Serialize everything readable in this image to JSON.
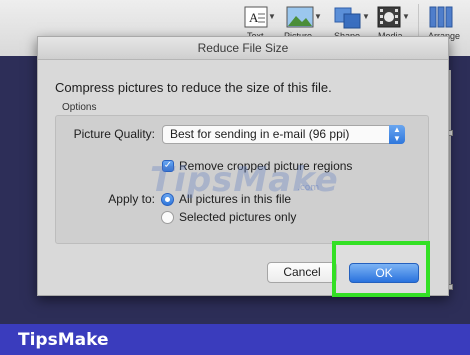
{
  "ribbon": {
    "items": [
      {
        "label": "Text",
        "icon": "text-box-icon"
      },
      {
        "label": "Picture",
        "icon": "picture-icon"
      },
      {
        "label": "Shape",
        "icon": "shape-icon"
      },
      {
        "label": "Media",
        "icon": "media-film-icon"
      },
      {
        "label": "Arrange",
        "icon": "arrange-icon"
      }
    ]
  },
  "dialog": {
    "title": "Reduce File Size",
    "description": "Compress pictures to reduce the size of this file.",
    "options_legend": "Options",
    "picture_quality_label": "Picture Quality:",
    "picture_quality_value": "Best for sending in e-mail (96 ppi)",
    "remove_cropped_label": "Remove cropped picture regions",
    "remove_cropped_checked": true,
    "apply_to_label": "Apply to:",
    "apply_options": [
      {
        "label": "All pictures in this file",
        "selected": true
      },
      {
        "label": "Selected pictures only",
        "selected": false
      }
    ],
    "cancel_label": "Cancel",
    "ok_label": "OK"
  },
  "watermark": {
    "text": "TipsMake",
    "suffix": ".com"
  },
  "brand": {
    "text": "TipsMake"
  },
  "colors": {
    "highlight": "#33e024",
    "accent_blue": "#2f77dc",
    "brand_bar": "#3a3cbd"
  }
}
